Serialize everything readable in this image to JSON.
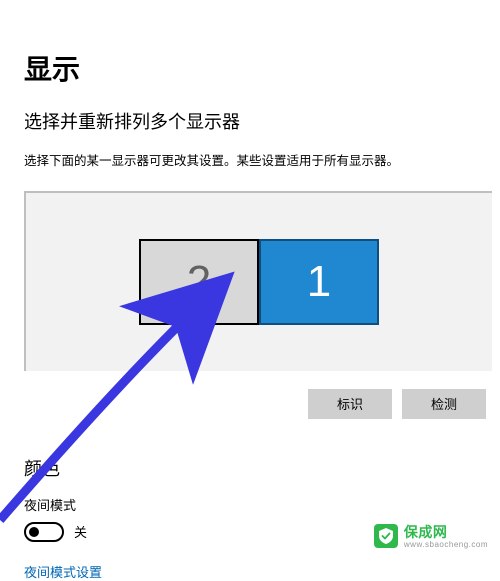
{
  "page": {
    "title": "显示",
    "subtitle": "选择并重新排列多个显示器",
    "description": "选择下面的某一显示器可更改其设置。某些设置适用于所有显示器。"
  },
  "monitors": {
    "left": {
      "label": "2",
      "selected": false
    },
    "right": {
      "label": "1",
      "selected": true
    }
  },
  "buttons": {
    "identify": "标识",
    "detect": "检测"
  },
  "color_section": {
    "title": "颜色",
    "night_light_label": "夜间模式",
    "toggle_state": "关",
    "settings_link": "夜间模式设置"
  },
  "watermark": {
    "brand": "保成网",
    "domain": "www.sbaocheng.com"
  }
}
